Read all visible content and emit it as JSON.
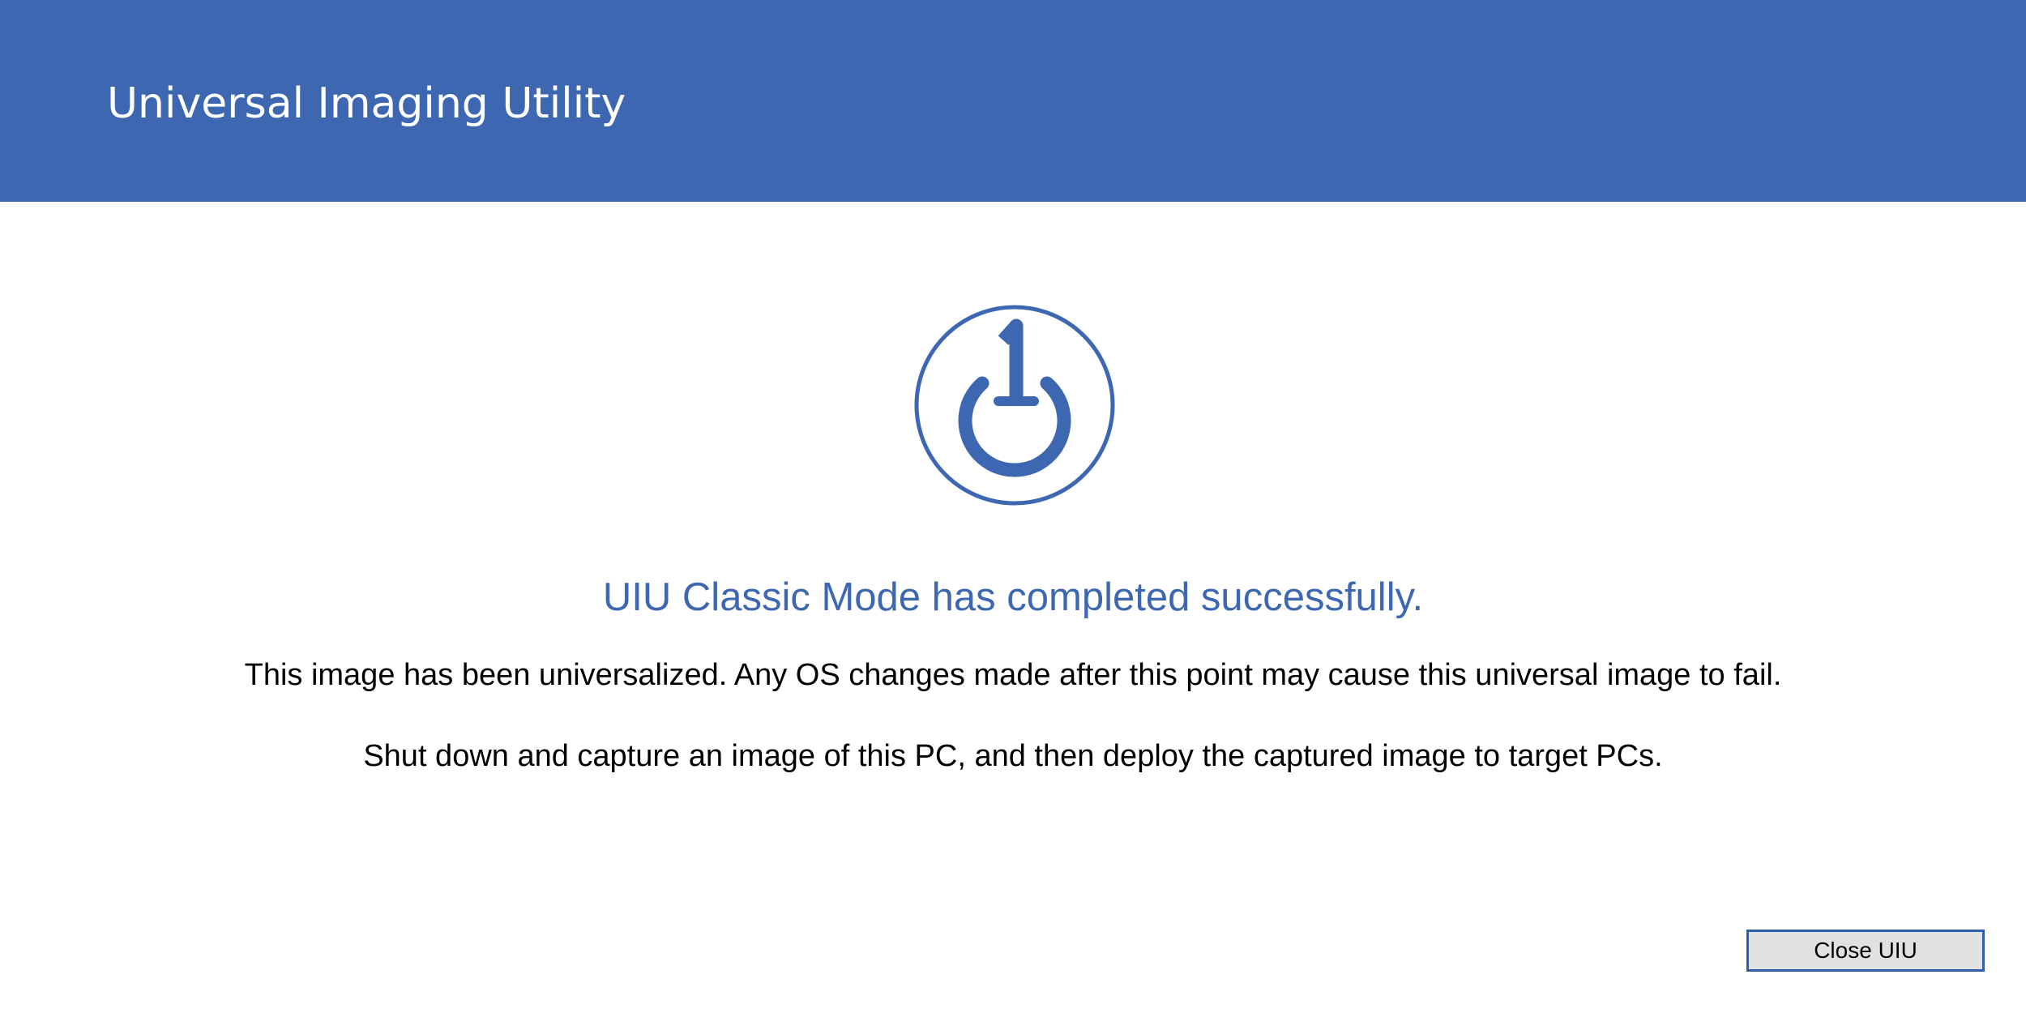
{
  "window": {
    "title": "Universal Imaging Utility"
  },
  "status": {
    "icon": "power-icon",
    "headline": "UIU Classic Mode has completed successfully.",
    "messages": [
      "This image has been universalized. Any OS changes made after this point may cause this universal image to fail.",
      "Shut down and capture an image of this PC, and then deploy the captured image to target PCs."
    ]
  },
  "actions": {
    "close_label": "Close UIU"
  },
  "colors": {
    "accent": "#3d67b0",
    "header_text": "#ffffff",
    "body_text": "#000000",
    "button_bg": "#e1e1e1",
    "button_border": "#2e5eac"
  }
}
